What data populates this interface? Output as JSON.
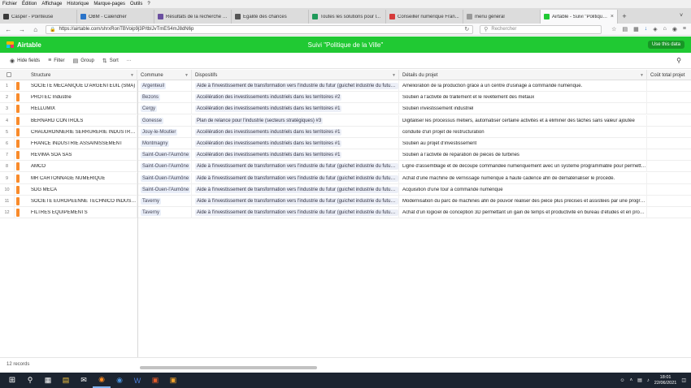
{
  "menu": [
    "Fichier",
    "Édition",
    "Affichage",
    "Historique",
    "Marque-pages",
    "Outils",
    "?"
  ],
  "tabs": [
    {
      "label": "Casper - Pointeuse",
      "color": "#3a3a3a",
      "active": false
    },
    {
      "label": "OBM - Calendrier",
      "color": "#2a73c9",
      "active": false
    },
    {
      "label": "Résultats de la recherche - ...",
      "color": "#6b4fa0",
      "active": false
    },
    {
      "label": "Égalité des chances",
      "color": "#555555",
      "active": false
    },
    {
      "label": "Toutes les solutions pour l...",
      "color": "#1f9a5a",
      "active": false
    },
    {
      "label": "Conseiller numérique Fran...",
      "color": "#d63b3b",
      "active": false
    },
    {
      "label": "menu général",
      "color": "#999999",
      "active": false
    },
    {
      "label": "Airtable - Suivi \"Politique ...",
      "color": "#20c933",
      "active": true
    }
  ],
  "browser": {
    "url": "https://airtable.com/shrxRonTBVoip9j3P/tblJvTmES4mJ8dN6p",
    "search_placeholder": "Rechercher"
  },
  "airtable": {
    "logo": "Airtable",
    "base_title": "Suivi \"Politique de la Ville\"",
    "use_data": "Use this data",
    "accent": "#20c933"
  },
  "toolbar": {
    "hide_fields": "Hide fields",
    "filter": "Filter",
    "group": "Group",
    "sort": "Sort",
    "more": "···"
  },
  "columns": {
    "structure": "Structure",
    "commune": "Commune",
    "dispositifs": "Dispositifs",
    "details": "Détails du projet",
    "cout": "Coût total projet"
  },
  "rows": [
    {
      "n": "1",
      "structure": "SOCIETE MECANIQUE D'ARGENTEUIL (SMA)",
      "commune": "Argenteuil",
      "dispositif": "Aide à l'investissement de transformation vers l'industrie du futur (guichet industrie du futur) #1",
      "details": "Amélioration de la production grâce à un centre d'usinage à commande numérique."
    },
    {
      "n": "2",
      "structure": "PROTEC Industrie",
      "commune": "Bezons",
      "dispositif": "Accélération des investissements industriels dans les territoires #2",
      "details": "Soutien à l'activité de traitement et le revêtement des métaux"
    },
    {
      "n": "3",
      "structure": "RELLUMIX",
      "commune": "Cergy",
      "dispositif": "Accélération des investissements industriels dans les territoires #1",
      "details": "Soutien investissement industriel"
    },
    {
      "n": "4",
      "structure": "BERNARD CONTROLS",
      "commune": "Gonesse",
      "dispositif": "Plan de relance pour l'industrie (secteurs stratégiques) #3",
      "details": "Digitaliser les processus métiers, automatiser certaine activités et à éliminer des tâches sans valeur ajoutée"
    },
    {
      "n": "5",
      "structure": "CHAUDRONNERIE SERRURERIE INDUSTRIELLE",
      "commune": "Jouy-le-Moutier",
      "dispositif": "Accélération des investissements industriels dans les territoires #1",
      "details": "conduite d'un projet de restructuration"
    },
    {
      "n": "6",
      "structure": "FRANCE INDUSTRIE ASSAINISSEMENT",
      "commune": "Montmagny",
      "dispositif": "Accélération des investissements industriels dans les territoires #1",
      "details": "Soutien au projet d'investissement"
    },
    {
      "n": "7",
      "structure": "REVIMA SOA SAS",
      "commune": "Saint-Ouen-l'Aumône",
      "dispositif": "Accélération des investissements industriels dans les territoires #1",
      "details": "Soutien à l'activité de réparation de pièces de turbines"
    },
    {
      "n": "8",
      "structure": "AMCO",
      "commune": "Saint-Ouen-l'Aumône",
      "dispositif": "Aide à l'investissement de transformation vers l'industrie du futur (guichet industrie du futur) #1",
      "details": "Ligne d'assemblage et de decoupe commandee numeriquement avec un systeme programmable pour permettre ..."
    },
    {
      "n": "9",
      "structure": "MR CARTONNAGE NUMERIQUE",
      "commune": "Saint-Ouen-l'Aumône",
      "dispositif": "Aide à l'investissement de transformation vers l'industrie du futur (guichet industrie du futur) #1",
      "details": "Achat d'une machine de vernissage numérique à haute cadence afin de dématérialiser le procédé."
    },
    {
      "n": "10",
      "structure": "SDG MECA",
      "commune": "Saint-Ouen-l'Aumône",
      "dispositif": "Aide à l'investissement de transformation vers l'industrie du futur (guichet industrie du futur) #2",
      "details": "Acquisition d'une tour à commande numérique"
    },
    {
      "n": "11",
      "structure": "SOCIETE EUROPEENNE TECHNICO INDUSTRIELLE",
      "commune": "Taverny",
      "dispositif": "Aide à l'investissement de transformation vers l'industrie du futur (guichet industrie du futur) #1",
      "details": "Modernisation du parc de machines afin de pouvoir réaliser des pièce plus précises et assistées par une progra..."
    },
    {
      "n": "12",
      "structure": "FILTRES EQUIPEMENTS",
      "commune": "Taverny",
      "dispositif": "Aide à l'investissement de transformation vers l'industrie du futur (guichet industrie du futur) #1",
      "details": "Achat d'un logiciel de conception 3D permettant un gain de temps et productivité en bureau d'études et en produ..."
    }
  ],
  "footer": {
    "records": "12 records"
  },
  "clock": {
    "time": "18:01",
    "date": "22/06/2021"
  }
}
